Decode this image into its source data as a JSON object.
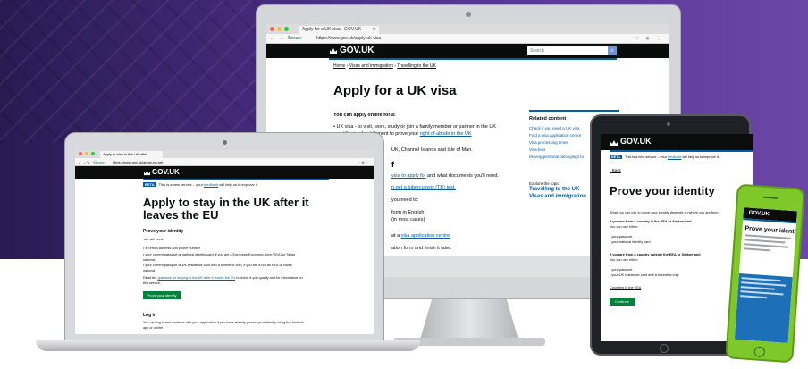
{
  "colors": {
    "gov_black": "#0b0c0c",
    "gov_blue": "#005ea5",
    "gov_link": "#005ea5",
    "gov_green_button": "#00823b",
    "background_purple": "#4a2f84",
    "phone_green": "#7ec82a"
  },
  "monitor": {
    "tab_title": "Apply for a UK visa - GOV.UK",
    "secure_label": "Secure",
    "url": "https://www.gov.uk/apply-uk-visa",
    "logo_text": "GOV.UK",
    "search_placeholder": "Search",
    "breadcrumb": [
      "Home",
      "Visas and immigration",
      "Travelling to the UK"
    ],
    "title": "Apply for a UK visa",
    "intro": "You can apply online for a:",
    "bullets": [
      {
        "text": "UK visa - to visit, work, study or join a family member or partner in the UK"
      },
      {
        "text": "certificate of entitlement to prove your ",
        "link": "right of abode in the UK"
      }
    ],
    "fragments": {
      "isle": "UK, Channel Islands and Isle of Man.",
      "f": "f",
      "visa_link": "visa to apply for",
      "visa_after": " and what documents you'll need.",
      "tb_link": "n get a tuberculosis (TB) test.",
      "need": "you need to:",
      "english": "form in English",
      "most": "(in most cases)",
      "centre_pre": "at a ",
      "centre_link": "visa application centre",
      "finish": "ation form and finish it later."
    },
    "related": {
      "heading": "Related content",
      "links": [
        "Check if you need a UK visa",
        "Find a visa application centre",
        "Visa processing times",
        "Visa fees",
        "Moving personal belongings to"
      ]
    },
    "explore": {
      "heading": "Explore the topic",
      "links": [
        "Travelling to the UK",
        "Visas and immigration"
      ]
    }
  },
  "laptop": {
    "tab_title": "Apply to stay in the UK after",
    "secure_label": "Secure",
    "url": "https://www.gov.uk/apply-eu-set",
    "logo_text": "GOV.UK",
    "beta_tag": "BETA",
    "beta_text": "This is a new service – your ",
    "beta_link": "feedback",
    "beta_after": " will help us to improve it.",
    "title": "Apply to stay in the UK after it leaves the EU",
    "section_heading": "Prove your identity",
    "need_label": "You will need:",
    "items": [
      "an email address and phone number",
      "your current passport or national identity card, if you are a European Economic Area (EEA) or Swiss national",
      "your current passport or UK residence card with a biometric chip, if you are a not an EEA or Swiss national"
    ],
    "read_pre": "Read the ",
    "read_link": "guidance on staying in the UK after it leaves the EU",
    "read_after": " to check if you qualify and for information on this service.",
    "button": "Prove your identity",
    "login_heading": "Log in",
    "login_text": "You can log in and continue with your application if you have already proven your identity using the Android app or online."
  },
  "tablet": {
    "logo_text": "GOV.UK",
    "beta_tag": "BETA",
    "beta_text": "This is a new service – your ",
    "beta_link": "feedback",
    "beta_after": " will help us to improve it.",
    "back": "Back",
    "title": "Prove your identity",
    "intro": "What you can use to prove your identity depends on where you are from.",
    "eea_heading": "If you are from a country in the EEA or Switzerland",
    "use_either": "You can use either:",
    "eea_items": [
      "your passport",
      "your national identity card"
    ],
    "non_eea_heading": "If you are from a country outside the EEA or Switzerland",
    "non_eea_items": [
      "your passport",
      "your UK residence card with a biometric chip"
    ],
    "countries_link": "Countries in the EEA",
    "button": "Continue"
  },
  "phone": {
    "logo_text": "GOV.UK",
    "title": "Prove your identity"
  }
}
